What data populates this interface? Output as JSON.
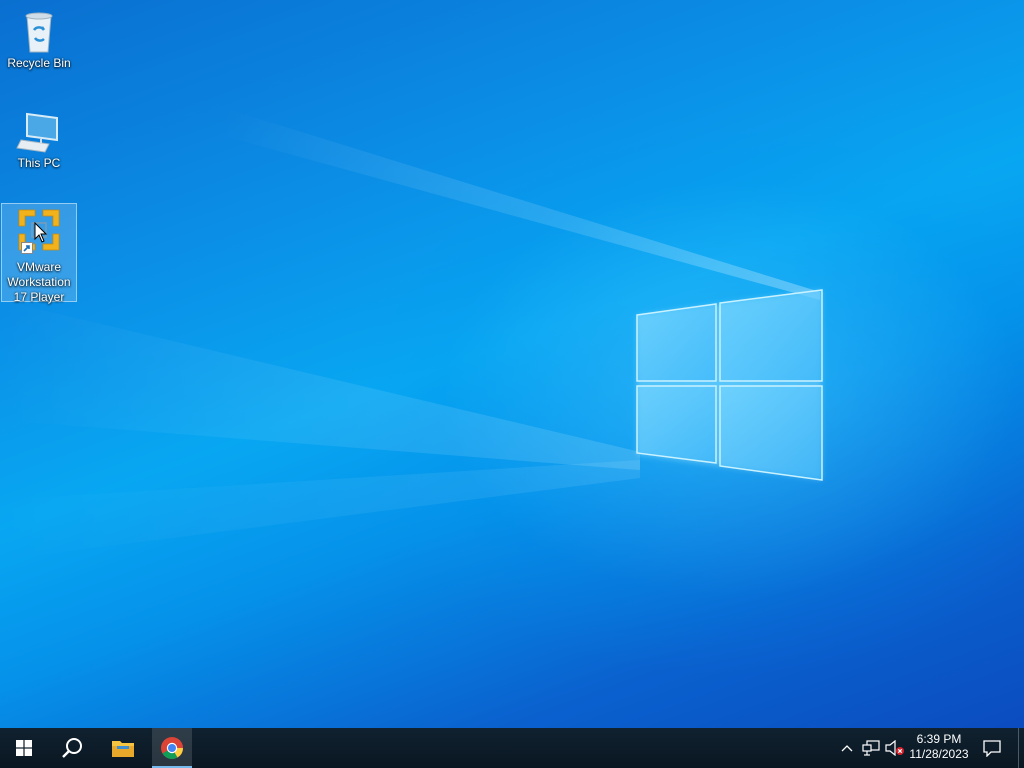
{
  "desktop": {
    "icons": [
      {
        "label": "Recycle Bin",
        "icon": "recycle-bin-icon"
      },
      {
        "label": "This PC",
        "icon": "this-pc-icon"
      },
      {
        "label": "VMware Workstation 17 Player",
        "icon": "vmware-icon",
        "selected": true
      }
    ]
  },
  "taskbar": {
    "start": {
      "icon": "windows-start-icon"
    },
    "search": {
      "icon": "search-icon"
    },
    "pinned": [
      {
        "name": "File Explorer",
        "icon": "file-explorer-icon"
      },
      {
        "name": "Google Chrome",
        "icon": "chrome-icon",
        "active": true
      }
    ],
    "tray": {
      "icons": [
        "chevron-up-icon",
        "network-icon",
        "volume-muted-icon"
      ],
      "time": "6:39 PM",
      "date": "11/28/2023",
      "notifications_icon": "action-center-icon"
    }
  },
  "colors": {
    "taskbar_bg": "#0b1a28",
    "accent": "#76b9ed",
    "wallpaper_blue": "#0a8fe8"
  }
}
